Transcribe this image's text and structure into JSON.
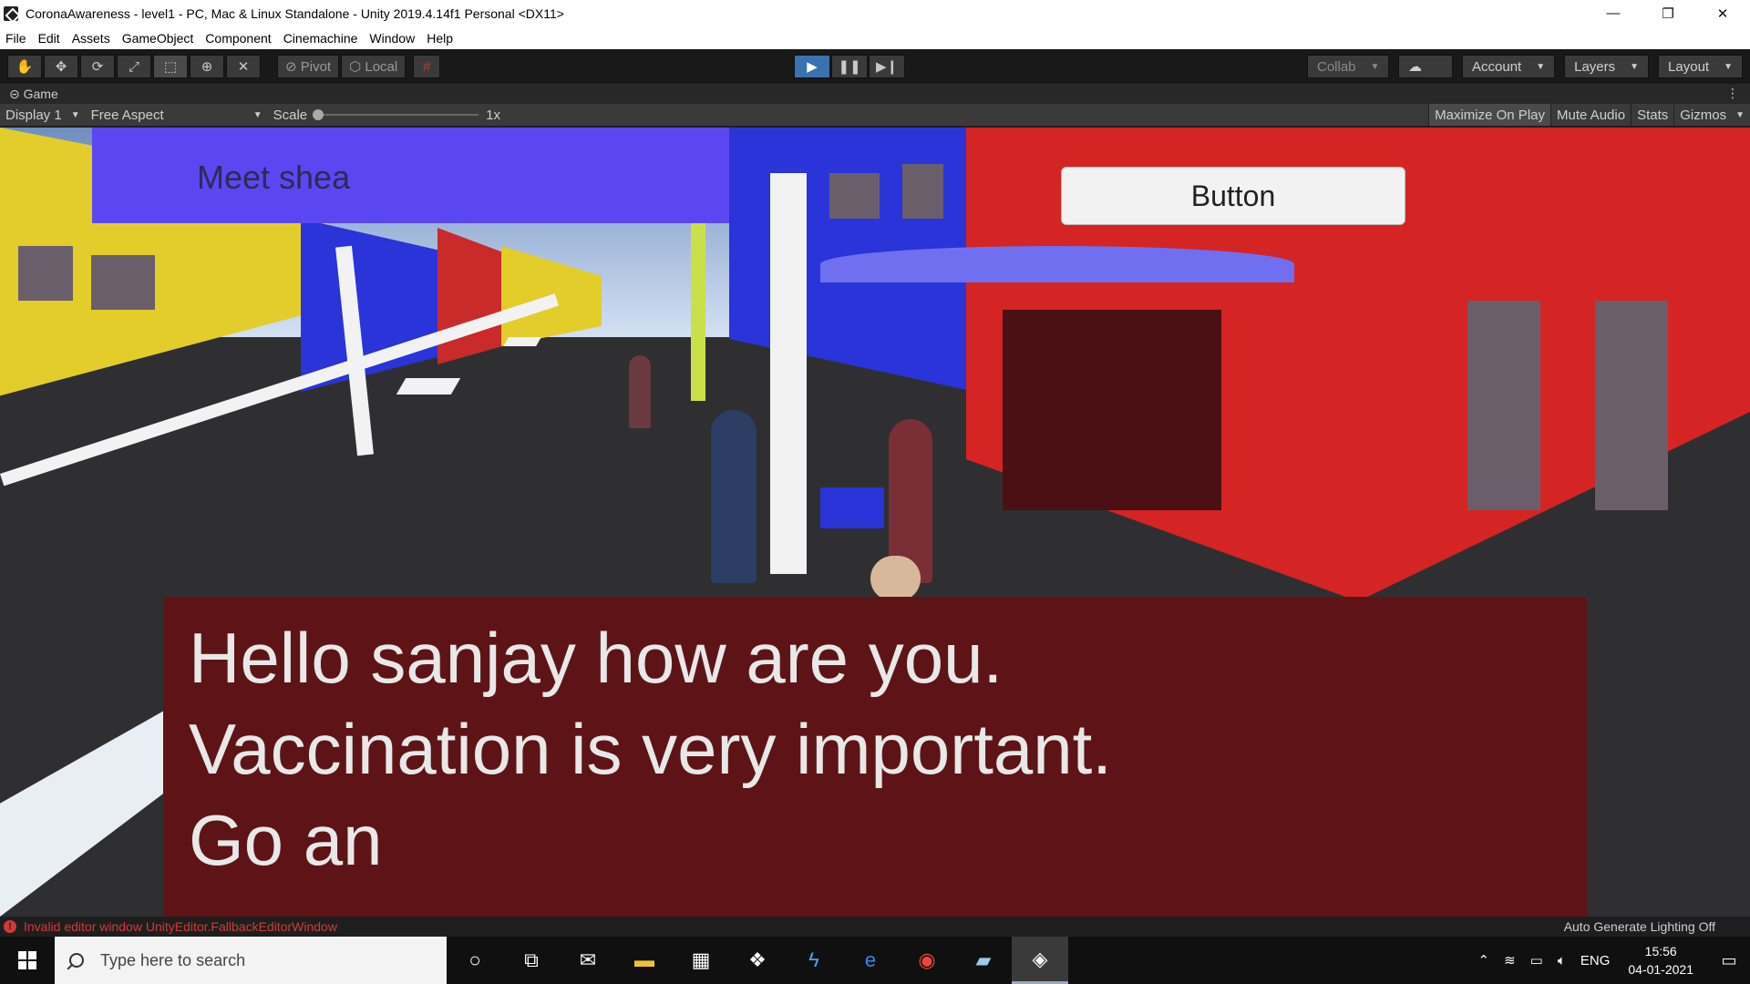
{
  "window": {
    "title": "CoronaAwareness - level1 - PC, Mac & Linux Standalone - Unity 2019.4.14f1 Personal <DX11>",
    "minimize": "—",
    "restore": "❐",
    "close": "✕"
  },
  "menu": [
    "File",
    "Edit",
    "Assets",
    "GameObject",
    "Component",
    "Cinemachine",
    "Window",
    "Help"
  ],
  "toolbar": {
    "tools": [
      "hand-tool",
      "move-tool",
      "rotate-tool",
      "scale-tool",
      "rect-tool",
      "transform-tool",
      "custom-tool"
    ],
    "pivot_label": "Pivot",
    "local_label": "Local",
    "play": "▶",
    "pause": "❚❚",
    "step": "▶❙",
    "collab_label": "Collab",
    "account_label": "Account",
    "layers_label": "Layers",
    "layout_label": "Layout"
  },
  "game_tab": {
    "label": "Game",
    "display": "Display 1",
    "aspect": "Free Aspect",
    "scale_label": "Scale",
    "scale_value": "1x",
    "maximize_on_play": "Maximize On Play",
    "mute_audio": "Mute Audio",
    "stats": "Stats",
    "gizmos": "Gizmos"
  },
  "game_ui": {
    "meet_text": "Meet shea",
    "button_label": "Button",
    "dialog_lines": [
      "Hello sanjay how are you.",
      "Vaccination is very important.",
      "Go an"
    ],
    "colors": {
      "meet_panel": "#5b47f2",
      "dialog_panel": "#5e1416"
    }
  },
  "status": {
    "error": "Invalid editor window UnityEditor.FallbackEditorWindow",
    "lighting": "Auto Generate Lighting Off"
  },
  "taskbar": {
    "search_placeholder": "Type here to search",
    "language": "ENG",
    "time": "15:56",
    "date": "04-01-2021"
  }
}
